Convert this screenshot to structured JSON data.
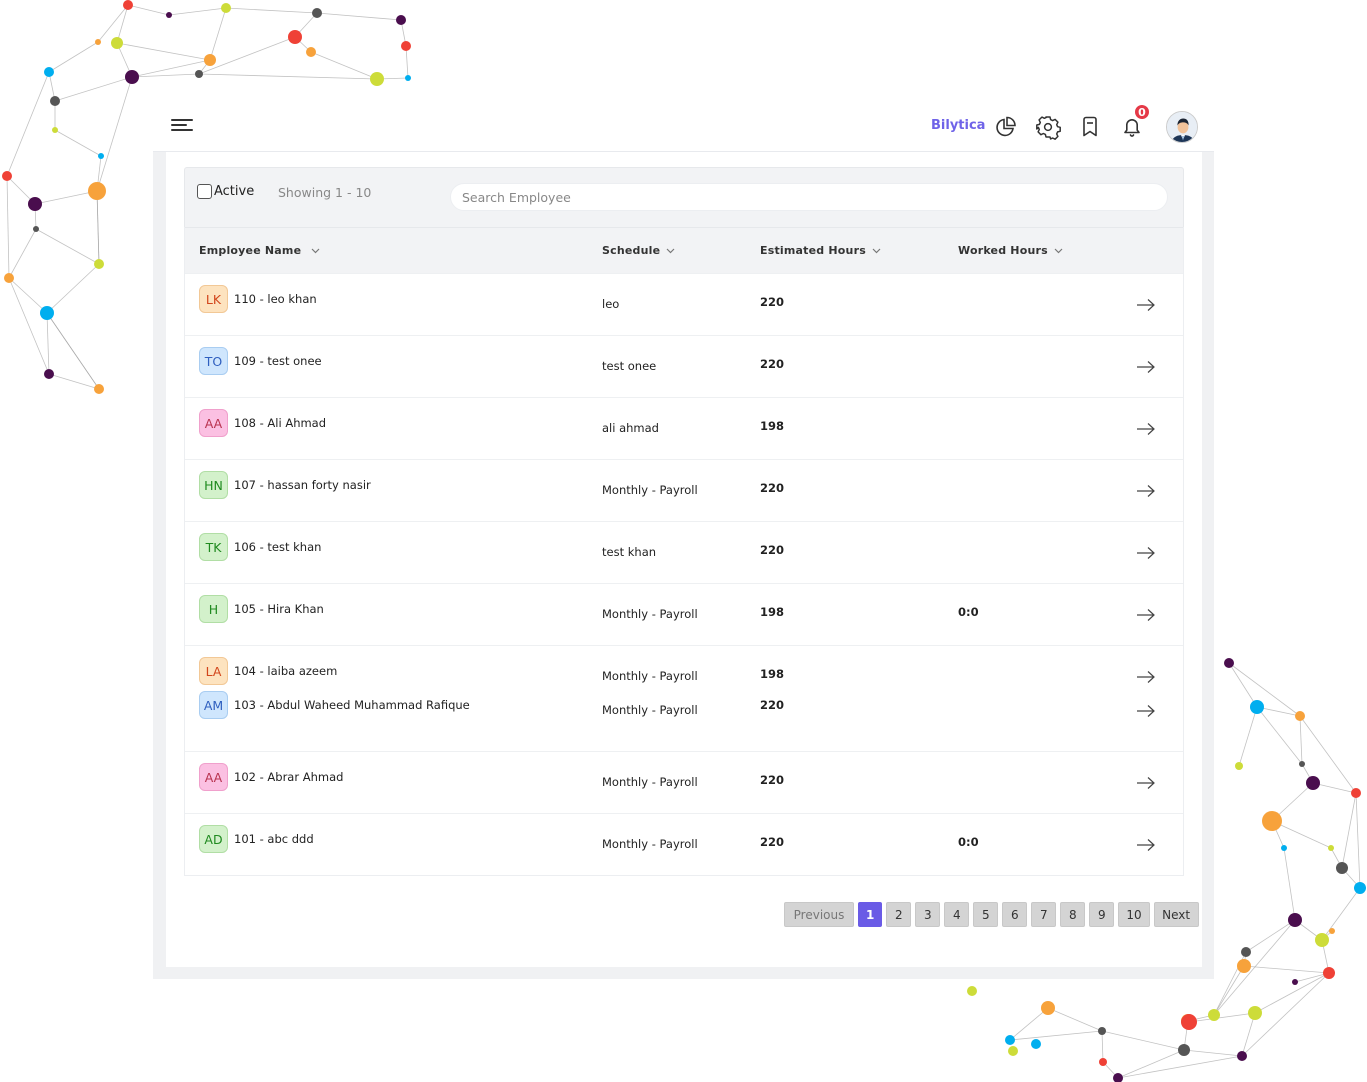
{
  "header": {
    "brand": "Bilytica",
    "notification_count": "0",
    "icons": [
      "menu-icon",
      "pie-chart-icon",
      "gear-icon",
      "bookmark-icon",
      "bell-icon",
      "user-avatar"
    ]
  },
  "filters": {
    "active_label": "Active",
    "active_checked": false,
    "showing_text": "Showing 1 - 10",
    "search_placeholder": "Search Employee",
    "search_value": ""
  },
  "table": {
    "columns": [
      {
        "label": "Employee Name",
        "sortable": true
      },
      {
        "label": "Schedule",
        "sortable": true
      },
      {
        "label": "Estimated Hours",
        "sortable": true
      },
      {
        "label": "Worked Hours",
        "sortable": true
      }
    ],
    "rows": [
      {
        "initials": "LK",
        "name": "110 - leo khan",
        "schedule": "leo",
        "estimated": "220",
        "worked": "",
        "bg": "#fde3bf",
        "fg": "#d2461c",
        "border": "#f2c896"
      },
      {
        "initials": "TO",
        "name": "109 - test onee",
        "schedule": "test onee",
        "estimated": "220",
        "worked": "",
        "bg": "#cfe6fd",
        "fg": "#2f5fbf",
        "border": "#a9cdf1"
      },
      {
        "initials": "AA",
        "name": "108 - Ali Ahmad",
        "schedule": "ali ahmad",
        "estimated": "198",
        "worked": "",
        "bg": "#fbc0e2",
        "fg": "#b8324f",
        "border": "#f0a0cc"
      },
      {
        "initials": "HN",
        "name": "107 - hassan forty nasir",
        "schedule": "Monthly - Payroll",
        "estimated": "220",
        "worked": "",
        "bg": "#d3f1cb",
        "fg": "#1f8a1f",
        "border": "#b1dea5"
      },
      {
        "initials": "TK",
        "name": "106 - test khan",
        "schedule": "test khan",
        "estimated": "220",
        "worked": "",
        "bg": "#d3f1cb",
        "fg": "#1f8a1f",
        "border": "#b1dea5"
      },
      {
        "initials": "H",
        "name": "105 - Hira Khan",
        "schedule": "Monthly - Payroll",
        "estimated": "198",
        "worked": "0:0",
        "bg": "#d3f1cb",
        "fg": "#1f8a1f",
        "border": "#b1dea5"
      },
      {
        "initials": "LA",
        "name": "104 - laiba azeem",
        "schedule": "Monthly - Payroll",
        "estimated": "198",
        "worked": "",
        "bg": "#fde3bf",
        "fg": "#d2461c",
        "border": "#f2c896"
      },
      {
        "initials": "AM",
        "name": "103 - Abdul Waheed Muhammad Rafique",
        "schedule": "Monthly - Payroll",
        "estimated": "220",
        "worked": "",
        "bg": "#cfe6fd",
        "fg": "#2f5fbf",
        "border": "#a9cdf1"
      },
      {
        "initials": "AA",
        "name": "102 - Abrar Ahmad",
        "schedule": "Monthly - Payroll",
        "estimated": "220",
        "worked": "",
        "bg": "#fbc0e2",
        "fg": "#b8324f",
        "border": "#f0a0cc"
      },
      {
        "initials": "AD",
        "name": "101 - abc ddd",
        "schedule": "Monthly - Payroll",
        "estimated": "220",
        "worked": "0:0",
        "bg": "#d3f1cb",
        "fg": "#1f8a1f",
        "border": "#b1dea5"
      }
    ]
  },
  "pagination": {
    "previous_label": "Previous",
    "next_label": "Next",
    "pages": [
      "1",
      "2",
      "3",
      "4",
      "5",
      "6",
      "7",
      "8",
      "9",
      "10"
    ],
    "current_page": "1"
  },
  "colors": {
    "brand": "#6f63e8",
    "active_page": "#6a5be6",
    "badge": "#e53947"
  }
}
